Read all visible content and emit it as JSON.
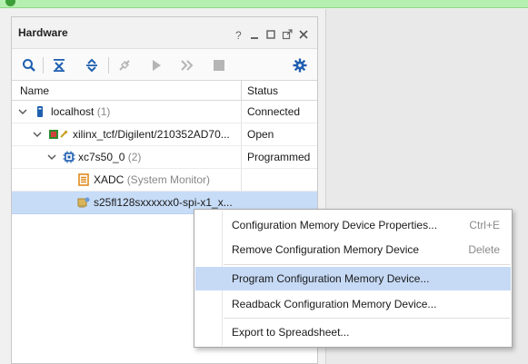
{
  "panel": {
    "title": "Hardware",
    "controls": [
      "help-icon",
      "minimize-icon",
      "maximize-icon",
      "float-icon",
      "close-icon"
    ]
  },
  "toolbar": {
    "buttons": [
      "search-icon",
      "collapse-all-icon",
      "expand-all-icon",
      "auto-connect-icon",
      "run-icon",
      "skip-icon",
      "stop-icon",
      "settings-icon"
    ]
  },
  "columns": {
    "name": "Name",
    "status": "Status"
  },
  "tree": [
    {
      "label": "localhost",
      "count": "(1)",
      "status": "Connected",
      "icon": "host-icon"
    },
    {
      "label": "xilinx_tcf/Digilent/210352AD70...",
      "count": "",
      "status": "Open",
      "icon": "cable-icon"
    },
    {
      "label": "xc7s50_0",
      "count": "(2)",
      "status": "Programmed",
      "icon": "chip-icon"
    },
    {
      "label": "XADC",
      "count": "(System Monitor)",
      "status": "",
      "icon": "xadc-icon"
    },
    {
      "label": "s25fl128sxxxxxx0-spi-x1_x...",
      "count": "",
      "status": "",
      "icon": "flash-memory-icon"
    }
  ],
  "context_menu": {
    "items": [
      {
        "label": "Configuration Memory Device Properties...",
        "shortcut": "Ctrl+E"
      },
      {
        "label": "Remove Configuration Memory Device",
        "shortcut": "Delete"
      },
      {
        "label": "Program Configuration Memory Device...",
        "shortcut": ""
      },
      {
        "label": "Readback Configuration Memory Device...",
        "shortcut": ""
      },
      {
        "label": "Export to Spreadsheet...",
        "shortcut": ""
      }
    ]
  },
  "colors": {
    "selection": "#c7dcf7",
    "menu_highlight": "#c6daf6",
    "accent_blue": "#1f5fb0",
    "notification_green": "#b6f0b0"
  }
}
